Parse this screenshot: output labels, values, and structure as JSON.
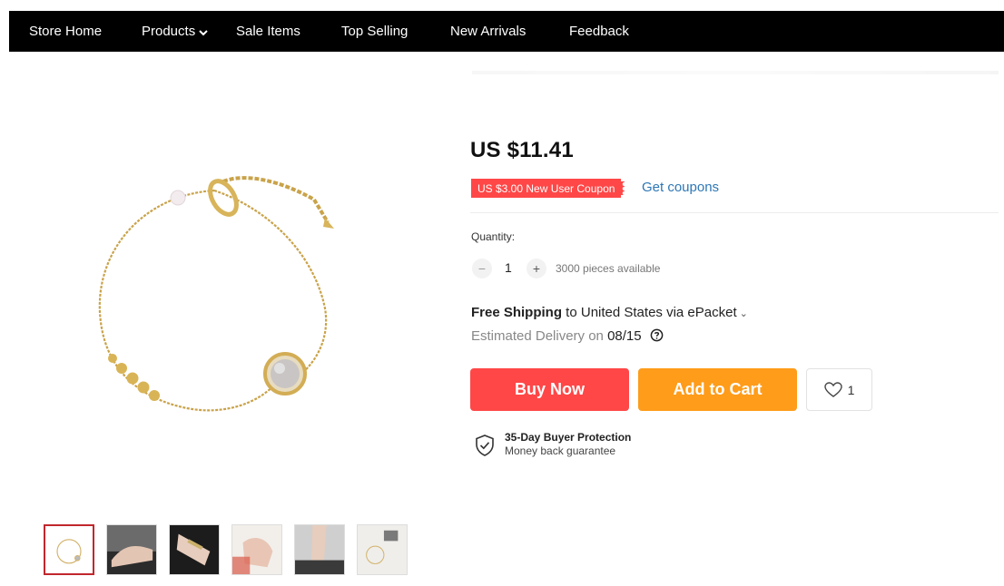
{
  "nav": {
    "items": [
      {
        "label": "Store Home"
      },
      {
        "label": "Products"
      },
      {
        "label": "Sale Items"
      },
      {
        "label": "Top Selling"
      },
      {
        "label": "New Arrivals"
      },
      {
        "label": "Feedback"
      }
    ]
  },
  "product": {
    "price": "US $11.41",
    "coupon_label": "US $3.00 New User Coupon",
    "get_coupons": "Get coupons",
    "quantity_label": "Quantity:",
    "quantity_value": "1",
    "minus_symbol": "−",
    "plus_symbol": "+",
    "available": "3000 pieces available",
    "shipping_bold": "Free Shipping",
    "shipping_rest": " to United States via ePacket",
    "shipping_chevron": "⌄",
    "delivery_label": "Estimated Delivery on ",
    "delivery_date": "08/15",
    "buy_now": "Buy Now",
    "add_to_cart": "Add to Cart",
    "wishlist_count": "1",
    "protection_title": "35-Day Buyer Protection",
    "protection_sub": "Money back guarantee",
    "thumbnails_count": 6,
    "active_thumbnail": 1
  },
  "colors": {
    "nav_bg": "#000000",
    "price_text": "#111111",
    "coupon_bg": "#ff4747",
    "link": "#2e77b6",
    "buy_now_bg": "#ff4747",
    "add_to_cart_bg": "#ff9c1a",
    "active_thumb_border": "#c0272d"
  }
}
